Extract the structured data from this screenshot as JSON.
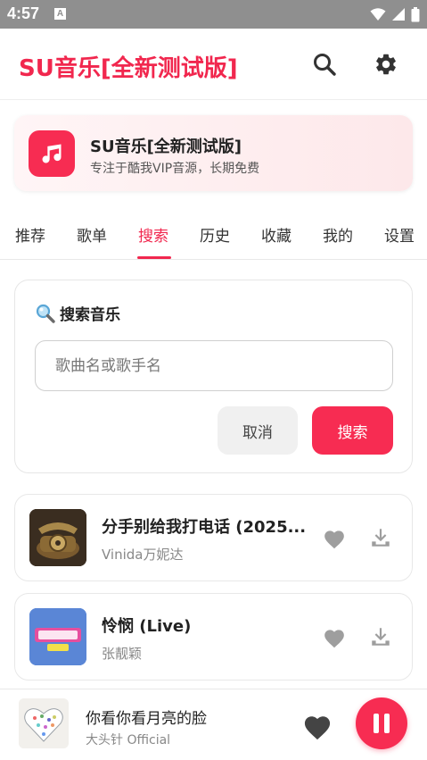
{
  "status_bar": {
    "time": "4:57",
    "notification_letter": "A",
    "icons": [
      "wifi-icon",
      "signal-icon",
      "battery-icon"
    ]
  },
  "app_bar": {
    "title": "SU音乐[全新测试版]",
    "actions": [
      "search-icon",
      "settings-icon"
    ]
  },
  "banner": {
    "title": "SU音乐[全新测试版]",
    "subtitle": "专注于酷我VIP音源，长期免费",
    "icon": "music-note-icon"
  },
  "tabs": {
    "items": [
      {
        "label": "推荐"
      },
      {
        "label": "歌单"
      },
      {
        "label": "搜索"
      },
      {
        "label": "历史"
      },
      {
        "label": "收藏"
      },
      {
        "label": "我的"
      },
      {
        "label": "设置"
      }
    ],
    "active": "搜索"
  },
  "search": {
    "heading": "搜索音乐",
    "heading_icon": "magnifier-emoji-icon",
    "input_value": "",
    "placeholder": "歌曲名或歌手名",
    "cancel_label": "取消",
    "search_label": "搜索"
  },
  "results": [
    {
      "title": "分手别给我打电话 (2025...",
      "artist": "Vinida万妮达",
      "cover": "vintage-telephone-cover"
    },
    {
      "title": "怜悯 (Live)",
      "artist": "张靓颖",
      "cover": "show-episode-7-cover"
    }
  ],
  "player": {
    "title": "你看你看月亮的脸",
    "artist": "大头针 Official",
    "state": "playing"
  },
  "colors": {
    "accent": "#f72c52",
    "accent_text": "#f1274e",
    "status_bar": "#8f8f8f",
    "icon_gray": "#9e9e9e"
  }
}
